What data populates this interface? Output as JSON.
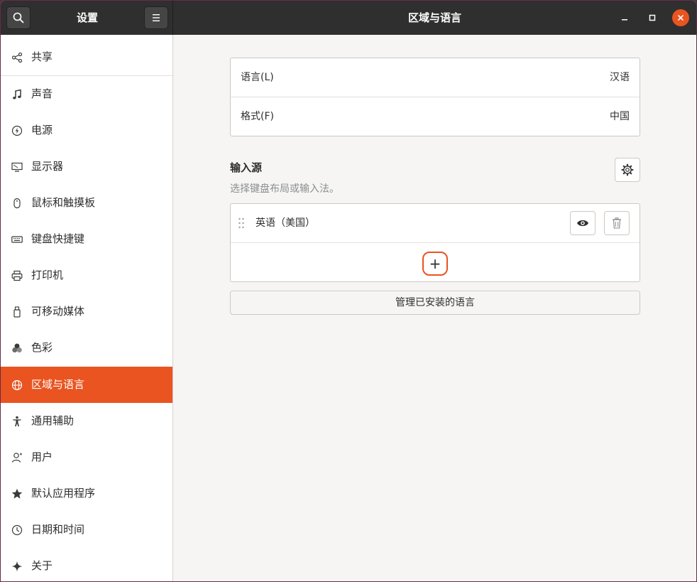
{
  "header": {
    "sidebar_title": "设置",
    "main_title": "区域与语言"
  },
  "sidebar": {
    "items": [
      {
        "label": "共享",
        "icon": "share-icon",
        "active": false
      },
      {
        "label": "声音",
        "icon": "music-note-icon",
        "active": false
      },
      {
        "label": "电源",
        "icon": "power-icon",
        "active": false
      },
      {
        "label": "显示器",
        "icon": "display-icon",
        "active": false
      },
      {
        "label": "鼠标和触摸板",
        "icon": "mouse-icon",
        "active": false
      },
      {
        "label": "键盘快捷键",
        "icon": "keyboard-icon",
        "active": false
      },
      {
        "label": "打印机",
        "icon": "printer-icon",
        "active": false
      },
      {
        "label": "可移动媒体",
        "icon": "usb-drive-icon",
        "active": false
      },
      {
        "label": "色彩",
        "icon": "color-icon",
        "active": false
      },
      {
        "label": "区域与语言",
        "icon": "globe-icon",
        "active": true
      },
      {
        "label": "通用辅助",
        "icon": "accessibility-icon",
        "active": false
      },
      {
        "label": "用户",
        "icon": "user-icon",
        "active": false
      },
      {
        "label": "默认应用程序",
        "icon": "star-icon",
        "active": false
      },
      {
        "label": "日期和时间",
        "icon": "clock-icon",
        "active": false
      },
      {
        "label": "关于",
        "icon": "sparkle-icon",
        "active": false
      }
    ]
  },
  "region": {
    "language_label": "语言(L)",
    "language_value": "汉语",
    "formats_label": "格式(F)",
    "formats_value": "中国"
  },
  "input_sources": {
    "title": "输入源",
    "subtitle": "选择键盘布局或输入法。",
    "sources": [
      {
        "label": "英语（美国）"
      }
    ],
    "add_label": "+"
  },
  "manage_button_label": "管理已安装的语言",
  "colors": {
    "accent": "#e95420",
    "header_bg": "#2f2f2f"
  }
}
